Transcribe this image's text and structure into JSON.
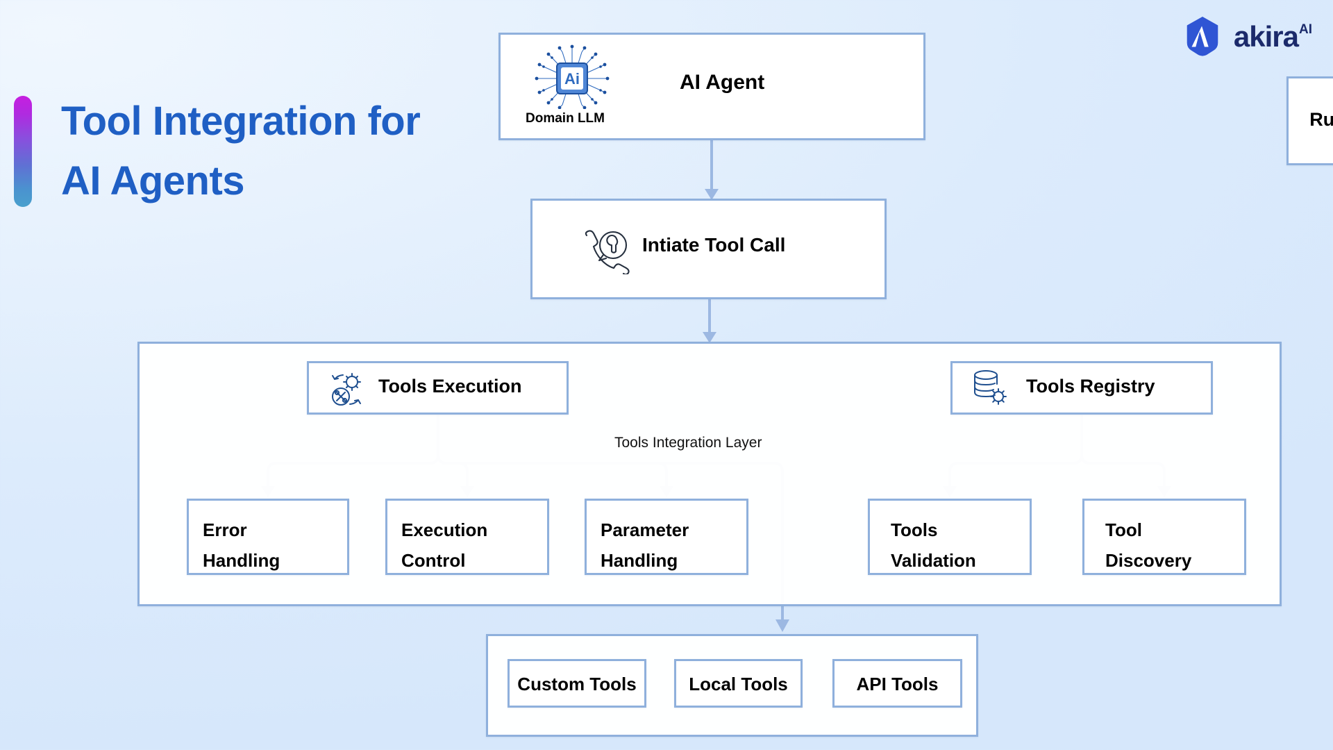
{
  "page": {
    "title_line1": "Tool Integration for",
    "title_line2": "AI Agents",
    "accent_from": "#c61fe0",
    "accent_to": "#49a0cd",
    "title_color": "#1f5fc4",
    "background_from": "#f0f7fe",
    "background_to": "#d6e7fb",
    "box_border_color": "#8fb0dc",
    "connector_color": "#9cb8e2"
  },
  "brand": {
    "name": "akira",
    "superscript": "AI",
    "mark_icon": "akira-hexagon-logo-icon",
    "mark_color": "#2f55d4",
    "text_color": "#1b2a6b"
  },
  "agent": {
    "title": "AI Agent",
    "llm_icon": "ai-chip-icon",
    "llm_chip_text": "Ai",
    "llm_label": "Domain LLM",
    "rules_label": "Rules"
  },
  "initiate": {
    "label": "Intiate Tool Call",
    "icon": "phone-wrench-tool-call-icon"
  },
  "layer": {
    "label": "Tools Integration Layer",
    "execution": {
      "label": "Tools Execution",
      "icon": "gear-tools-refresh-icon",
      "children": [
        {
          "line1": "Error",
          "line2": "Handling"
        },
        {
          "line1": "Execution",
          "line2": "Control"
        },
        {
          "line1": "Parameter",
          "line2": "Handling"
        }
      ]
    },
    "registry": {
      "label": "Tools Registry",
      "icon": "database-gear-icon",
      "children": [
        {
          "line1": "Tools",
          "line2": "Validation"
        },
        {
          "line1": "Tool",
          "line2": "Discovery"
        }
      ]
    }
  },
  "tools": {
    "items": [
      {
        "label": "Custom Tools"
      },
      {
        "label": "Local Tools"
      },
      {
        "label": "API Tools"
      }
    ]
  }
}
